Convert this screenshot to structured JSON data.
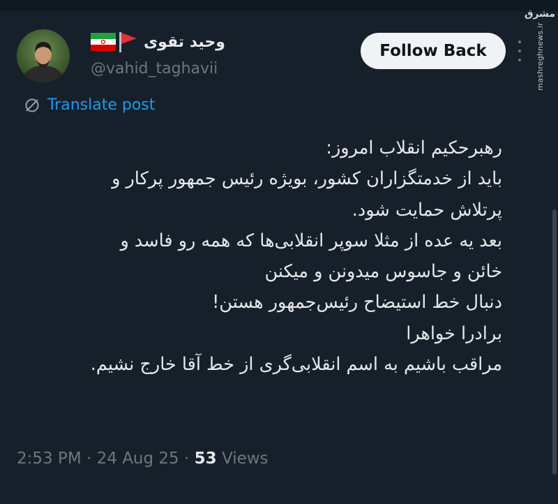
{
  "watermark": {
    "logo": "مشرق",
    "site": "mashreghnews.ir"
  },
  "author": {
    "name": "وحید تقوی",
    "handle": "@vahid_taghavii",
    "flag_icons": [
      "iran-flag-icon",
      "red-pennant-icon"
    ]
  },
  "actions": {
    "follow_label": "Follow Back"
  },
  "translate": {
    "label": "Translate post"
  },
  "tweet": {
    "lines": [
      "رهبرحکیم انقلاب امروز:",
      "باید از خدمتگزاران کشور، بویژه رئیس جمهور پرکار و",
      "پرتلاش حمایت شود.",
      "بعد یه عده از مثلا سوپر انقلابی‌ها که همه رو فاسد و",
      "خائن و جاسوس میدونن و میکنن",
      "دنبال خط استیضاح رئیس‌جمهور هستن!",
      "برادرا خواهرا",
      "مراقب باشیم به اسم انقلابی‌گری از خط آقا خارج نشیم."
    ]
  },
  "meta": {
    "time": "2:53 PM",
    "separator": " · ",
    "date": "24 Aug 25",
    "views_count": "53",
    "views_label": " Views"
  },
  "colors": {
    "background": "#16202b",
    "text": "#e7e9ea",
    "muted": "#71767b",
    "accent": "#1d9bf0",
    "button_bg": "#eff3f4"
  }
}
